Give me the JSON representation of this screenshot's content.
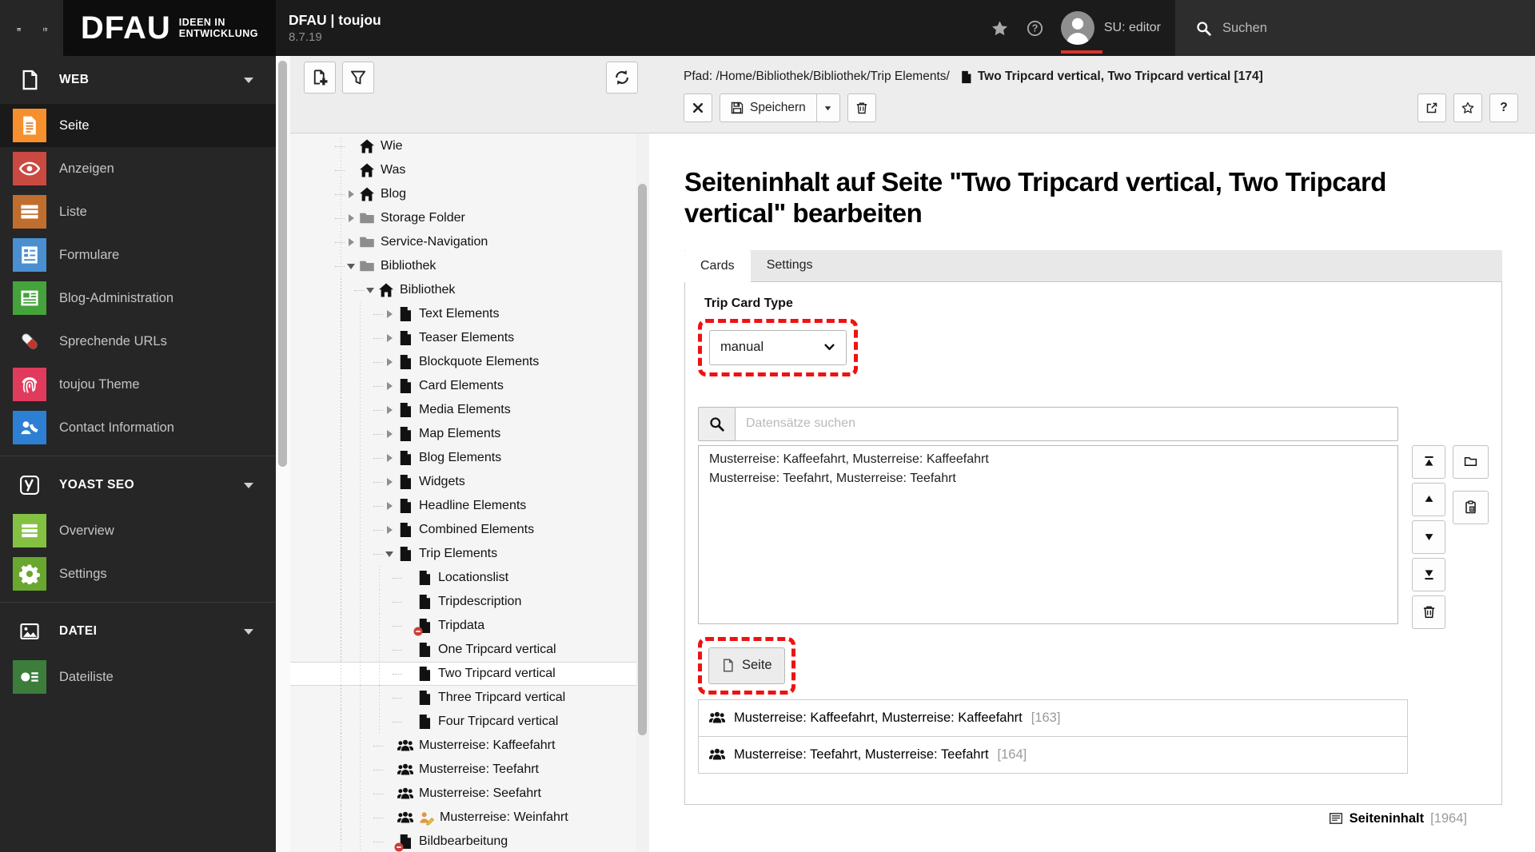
{
  "topbar": {
    "logo_main": "DFAU",
    "logo_sub1": "IDEEN IN",
    "logo_sub2": "ENTWICKLUNG",
    "site_title": "DFAU | toujou",
    "version": "8.7.19",
    "user_label": "SU: editor",
    "search_placeholder": "Suchen"
  },
  "module_menu": {
    "sections": [
      {
        "label": "WEB",
        "icon": "page-outline",
        "items": [
          {
            "label": "Seite",
            "icon": "doc-lines",
            "color": "#f6902e",
            "active": true
          },
          {
            "label": "Anzeigen",
            "icon": "eye",
            "color": "#ca4a42",
            "active": false
          },
          {
            "label": "Liste",
            "icon": "list-mod",
            "color": "#c06e2e",
            "active": false
          },
          {
            "label": "Formulare",
            "icon": "form-mod",
            "color": "#4a8fd0",
            "active": false
          },
          {
            "label": "Blog-Administration",
            "icon": "news-mod",
            "color": "#44a33b",
            "active": false
          },
          {
            "label": "Sprechende URLs",
            "icon": "pill",
            "color": "transparent",
            "active": false
          },
          {
            "label": "toujou Theme",
            "icon": "fingerprint",
            "color": "#e03a5d",
            "active": false
          },
          {
            "label": "Contact Information",
            "icon": "contact-mod",
            "color": "#2d7fd3",
            "active": false
          }
        ]
      },
      {
        "label": "YOAST SEO",
        "icon": "yoast",
        "items": [
          {
            "label": "Overview",
            "icon": "overview-mod",
            "color": "#84c142",
            "active": false
          },
          {
            "label": "Settings",
            "icon": "gear",
            "color": "#69a72e",
            "active": false
          }
        ]
      },
      {
        "label": "DATEI",
        "icon": "image-outline",
        "items": [
          {
            "label": "Dateiliste",
            "icon": "filelist-mod",
            "color": "#3c7d3c",
            "active": false
          }
        ]
      }
    ]
  },
  "tree": {
    "items": [
      {
        "label": "Wie",
        "icon": "home",
        "depth": 0,
        "expander": "none",
        "selected": false,
        "overlay": "none"
      },
      {
        "label": "Was",
        "icon": "home",
        "depth": 0,
        "expander": "none",
        "selected": false,
        "overlay": "none"
      },
      {
        "label": "Blog",
        "icon": "home",
        "depth": 0,
        "expander": "collapsed",
        "selected": false,
        "overlay": "none"
      },
      {
        "label": "Storage Folder",
        "icon": "folder",
        "depth": 0,
        "expander": "collapsed",
        "selected": false,
        "overlay": "none"
      },
      {
        "label": "Service-Navigation",
        "icon": "folder",
        "depth": 0,
        "expander": "collapsed",
        "selected": false,
        "overlay": "none"
      },
      {
        "label": "Bibliothek",
        "icon": "folder",
        "depth": 0,
        "expander": "expanded",
        "selected": false,
        "overlay": "none"
      },
      {
        "label": "Bibliothek",
        "icon": "home",
        "depth": 1,
        "expander": "expanded",
        "selected": false,
        "overlay": "none"
      },
      {
        "label": "Text Elements",
        "icon": "page",
        "depth": 2,
        "expander": "collapsed",
        "selected": false,
        "overlay": "none"
      },
      {
        "label": "Teaser Elements",
        "icon": "page",
        "depth": 2,
        "expander": "collapsed",
        "selected": false,
        "overlay": "none"
      },
      {
        "label": "Blockquote Elements",
        "icon": "page",
        "depth": 2,
        "expander": "collapsed",
        "selected": false,
        "overlay": "none"
      },
      {
        "label": "Card Elements",
        "icon": "page",
        "depth": 2,
        "expander": "collapsed",
        "selected": false,
        "overlay": "none"
      },
      {
        "label": "Media Elements",
        "icon": "page",
        "depth": 2,
        "expander": "collapsed",
        "selected": false,
        "overlay": "none"
      },
      {
        "label": "Map Elements",
        "icon": "page",
        "depth": 2,
        "expander": "collapsed",
        "selected": false,
        "overlay": "none"
      },
      {
        "label": "Blog Elements",
        "icon": "page",
        "depth": 2,
        "expander": "collapsed",
        "selected": false,
        "overlay": "none"
      },
      {
        "label": "Widgets",
        "icon": "page",
        "depth": 2,
        "expander": "collapsed",
        "selected": false,
        "overlay": "none"
      },
      {
        "label": "Headline Elements",
        "icon": "page",
        "depth": 2,
        "expander": "collapsed",
        "selected": false,
        "overlay": "none"
      },
      {
        "label": "Combined Elements",
        "icon": "page",
        "depth": 2,
        "expander": "collapsed",
        "selected": false,
        "overlay": "none"
      },
      {
        "label": "Trip Elements",
        "icon": "page",
        "depth": 2,
        "expander": "expanded",
        "selected": false,
        "overlay": "none"
      },
      {
        "label": "Locationslist",
        "icon": "page",
        "depth": 3,
        "expander": "none",
        "selected": false,
        "overlay": "none"
      },
      {
        "label": "Tripdescription",
        "icon": "page",
        "depth": 3,
        "expander": "none",
        "selected": false,
        "overlay": "none"
      },
      {
        "label": "Tripdata",
        "icon": "page",
        "depth": 3,
        "expander": "none",
        "selected": false,
        "overlay": "hidden"
      },
      {
        "label": "One Tripcard vertical",
        "icon": "page",
        "depth": 3,
        "expander": "none",
        "selected": false,
        "overlay": "none"
      },
      {
        "label": "Two Tripcard vertical",
        "icon": "page",
        "depth": 3,
        "expander": "none",
        "selected": true,
        "overlay": "none"
      },
      {
        "label": "Three Tripcard vertical",
        "icon": "page",
        "depth": 3,
        "expander": "none",
        "selected": false,
        "overlay": "none"
      },
      {
        "label": "Four Tripcard vertical",
        "icon": "page",
        "depth": 3,
        "expander": "none",
        "selected": false,
        "overlay": "none"
      },
      {
        "label": "Musterreise: Kaffeefahrt",
        "icon": "users",
        "depth": 2,
        "expander": "none",
        "selected": false,
        "overlay": "none"
      },
      {
        "label": "Musterreise: Teefahrt",
        "icon": "users",
        "depth": 2,
        "expander": "none",
        "selected": false,
        "overlay": "none"
      },
      {
        "label": "Musterreise: Seefahrt",
        "icon": "users",
        "depth": 2,
        "expander": "none",
        "selected": false,
        "overlay": "none"
      },
      {
        "label": "Musterreise: Weinfahrt",
        "icon": "users",
        "depth": 2,
        "expander": "none",
        "selected": false,
        "overlay": "edit"
      },
      {
        "label": "Bildbearbeitung",
        "icon": "page",
        "depth": 2,
        "expander": "none",
        "selected": false,
        "overlay": "hidden"
      }
    ]
  },
  "docheader": {
    "path_prefix": "Pfad: /Home/Bibliothek/Bibliothek/Trip Elements/",
    "record_title": "Two Tripcard vertical, Two Tripcard vertical [174]",
    "save_label": "Speichern"
  },
  "content": {
    "heading": "Seiteninhalt auf Seite \"Two Tripcard vertical, Two Tripcard vertical\" bearbeiten",
    "tabs": [
      {
        "label": "Cards",
        "active": true
      },
      {
        "label": "Settings",
        "active": false
      }
    ],
    "trip_card_type_label": "Trip Card Type",
    "trip_card_type_value": "manual",
    "search_placeholder": "Datensätze suchen",
    "selected_items": [
      "Musterreise: Kaffeefahrt, Musterreise: Kaffeefahrt",
      "Musterreise: Teefahrt, Musterreise: Teefahrt"
    ],
    "new_record_button": "Seite",
    "records": [
      {
        "title": "Musterreise: Kaffeefahrt, Musterreise: Kaffeefahrt",
        "id": "[163]"
      },
      {
        "title": "Musterreise: Teefahrt, Musterreise: Teefahrt",
        "id": "[164]"
      }
    ],
    "footer_label": "Seiteninhalt",
    "footer_id": "[1964]"
  },
  "colors": {
    "annotation_red": "#ee1212",
    "switch_user_red": "#d9342b",
    "topbar_bg": "#1b1b1b",
    "sidebar_bg": "#262626"
  }
}
